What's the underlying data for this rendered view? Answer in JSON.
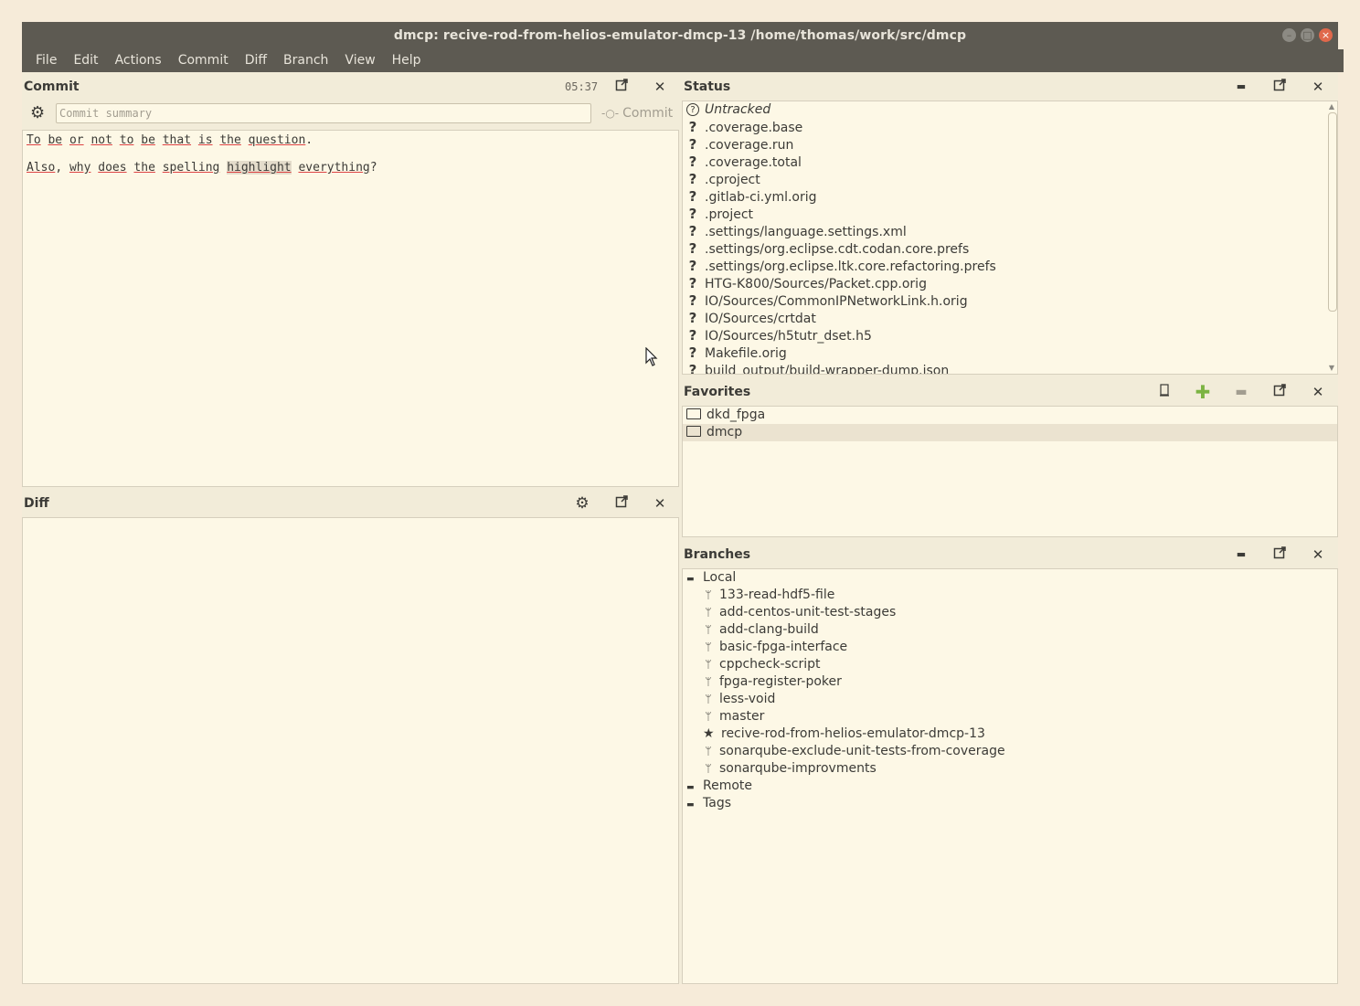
{
  "window": {
    "title": "dmcp: recive-rod-from-helios-emulator-dmcp-13 /home/thomas/work/src/dmcp"
  },
  "menu": [
    "File",
    "Edit",
    "Actions",
    "Commit",
    "Diff",
    "Branch",
    "View",
    "Help"
  ],
  "commit_panel": {
    "title": "Commit",
    "time": "05:37",
    "summary_placeholder": "Commit summary",
    "commit_button": "Commit",
    "message_lines": [
      [
        "To",
        " ",
        "be",
        " ",
        "or",
        " ",
        "not",
        " ",
        "to",
        " ",
        "be",
        " ",
        "that",
        " ",
        "is",
        " ",
        "the",
        " ",
        "question",
        "."
      ],
      [
        "Also",
        ", ",
        "why",
        " ",
        "does",
        " ",
        "the",
        " ",
        "spelling",
        " ",
        "highlight",
        " ",
        "everything",
        "?"
      ]
    ]
  },
  "diff_panel": {
    "title": "Diff"
  },
  "status_panel": {
    "title": "Status",
    "group": "Untracked",
    "files": [
      ".coverage.base",
      ".coverage.run",
      ".coverage.total",
      ".cproject",
      ".gitlab-ci.yml.orig",
      ".project",
      ".settings/language.settings.xml",
      ".settings/org.eclipse.cdt.codan.core.prefs",
      ".settings/org.eclipse.ltk.core.refactoring.prefs",
      "HTG-K800/Sources/Packet.cpp.orig",
      "IO/Sources/CommonIPNetworkLink.h.orig",
      "IO/Sources/crtdat",
      "IO/Sources/h5tutr_dset.h5",
      "Makefile.orig",
      "build_output/build-wrapper-dump.json"
    ]
  },
  "favorites_panel": {
    "title": "Favorites",
    "items": [
      "dkd_fpga",
      "dmcp"
    ]
  },
  "branches_panel": {
    "title": "Branches",
    "local_label": "Local",
    "local": [
      "133-read-hdf5-file",
      "add-centos-unit-test-stages",
      "add-clang-build",
      "basic-fpga-interface",
      "cppcheck-script",
      "fpga-register-poker",
      "less-void",
      "master",
      "recive-rod-from-helios-emulator-dmcp-13",
      "sonarqube-exclude-unit-tests-from-coverage",
      "sonarqube-improvments"
    ],
    "current": "recive-rod-from-helios-emulator-dmcp-13",
    "remote_label": "Remote",
    "tags_label": "Tags"
  },
  "colors": {
    "titlebar": "#5d5a52",
    "panel_bg": "#fdf8e6",
    "close_button": "#e0684b",
    "add_button": "#7cb342"
  }
}
